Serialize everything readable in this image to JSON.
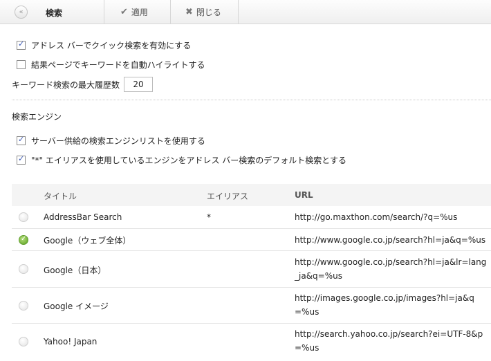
{
  "toolbar": {
    "back_icon": "double-chevron-left-icon",
    "title": "検索",
    "apply_label": "適用",
    "close_label": "閉じる"
  },
  "options": {
    "quick_search": {
      "label": "アドレス バーでクイック検索を有効にする",
      "checked": true
    },
    "highlight": {
      "label": "結果ページでキーワードを自動ハイライトする",
      "checked": false
    },
    "max_history_label": "キーワード検索の最大履歴数",
    "max_history_value": "20"
  },
  "engines": {
    "section_title": "検索エンジン",
    "server_list": {
      "label": "サーバー供給の検索エンジンリストを使用する",
      "checked": true
    },
    "default_alias": {
      "label": "\"*\" エイリアスを使用しているエンジンをアドレス バー検索のデフォルト検索とする",
      "checked": true
    }
  },
  "table": {
    "headers": {
      "title": "タイトル",
      "alias": "エイリアス",
      "url": "URL"
    },
    "rows": [
      {
        "title": "AddressBar Search",
        "alias": "*",
        "url": "http://go.maxthon.com/search/?q=%us",
        "selected": false
      },
      {
        "title": "Google（ウェブ全体）",
        "alias": "",
        "url": "http://www.google.co.jp/search?hl=ja&q=%us",
        "selected": true
      },
      {
        "title": "Google（日本）",
        "alias": "",
        "url": "http://www.google.co.jp/search?hl=ja&lr=lang_ja&q=%us",
        "selected": false
      },
      {
        "title": "Google イメージ",
        "alias": "",
        "url": "http://images.google.co.jp/images?hl=ja&q=%us",
        "selected": false
      },
      {
        "title": "Yahoo! Japan",
        "alias": "",
        "url": "http://search.yahoo.co.jp/search?ei=UTF-8&p=%us",
        "selected": false
      }
    ]
  }
}
